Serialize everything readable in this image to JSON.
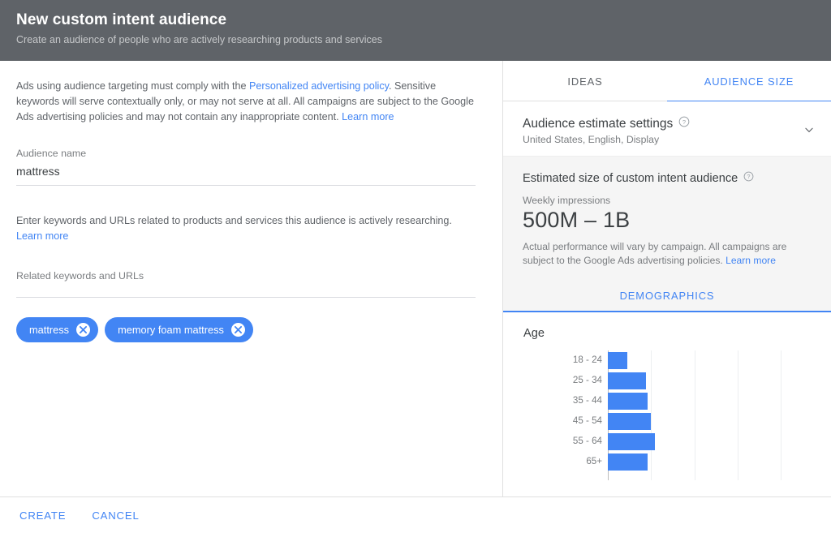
{
  "header": {
    "title": "New custom intent audience",
    "subtitle": "Create an audience of people who are actively researching products and services"
  },
  "left": {
    "policy": {
      "part1": "Ads using audience targeting must comply with the ",
      "link1": "Personalized advertising policy",
      "part2": ". Sensitive keywords will serve contextually only, or may not serve at all. All campaigns are subject to the Google Ads advertising policies and may not contain any inappropriate content. ",
      "link2": "Learn more"
    },
    "audience_name_label": "Audience name",
    "audience_name_value": "mattress",
    "audience_name_placeholder": "Audience name",
    "keywords_hint": "Enter keywords and URLs related to products and services this audience is actively researching.",
    "keywords_hint_link": "Learn more",
    "keywords_field_label": "Related keywords and URLs",
    "keywords_field_placeholder": "Related keywords and URLs",
    "chips": [
      {
        "label": "mattress",
        "remove_icon": "close-circle-icon"
      },
      {
        "label": "memory foam mattress",
        "remove_icon": "close-circle-icon"
      }
    ]
  },
  "right": {
    "tabs": [
      {
        "label": "IDEAS",
        "active": false
      },
      {
        "label": "AUDIENCE SIZE",
        "active": true
      }
    ],
    "settings": {
      "title": "Audience estimate settings",
      "help_icon": "help-circle-icon",
      "subtitle": "United States, English, Display",
      "expand_icon": "chevron-down-icon"
    },
    "estimate": {
      "title": "Estimated size of custom intent audience",
      "help_icon": "help-circle-icon",
      "metric_label": "Weekly impressions",
      "value": "500M – 1B",
      "note_part1": "Actual performance will vary by campaign. All campaigns are subject to the Google Ads advertising policies. ",
      "note_link": "Learn more"
    },
    "demographics_tab": {
      "label": "DEMOGRAPHICS",
      "active": true
    }
  },
  "chart_data": {
    "type": "bar",
    "title": "Age",
    "orientation": "horizontal",
    "categories": [
      "18 - 24",
      "25 - 34",
      "35 - 44",
      "45 - 54",
      "55 - 64",
      "65+"
    ],
    "values": [
      5.5,
      10.5,
      11.0,
      12.0,
      13.0,
      11.0
    ],
    "xlabel": "",
    "ylabel": "",
    "xlim": [
      0,
      48
    ],
    "grid": true,
    "gridlines": [
      0,
      12,
      24,
      36,
      48
    ],
    "bar_color": "#4285f4",
    "tick_labels_visible": false,
    "legend": null,
    "clipped_bottom": true
  },
  "footer": {
    "create_label": "CREATE",
    "cancel_label": "CANCEL"
  },
  "colors": {
    "header_bg": "#5f6368",
    "accent": "#4285f4",
    "panel_bg": "#f5f5f5",
    "text_primary": "#3c4043",
    "text_secondary": "#7a7d80",
    "divider": "#e0e0e0"
  }
}
